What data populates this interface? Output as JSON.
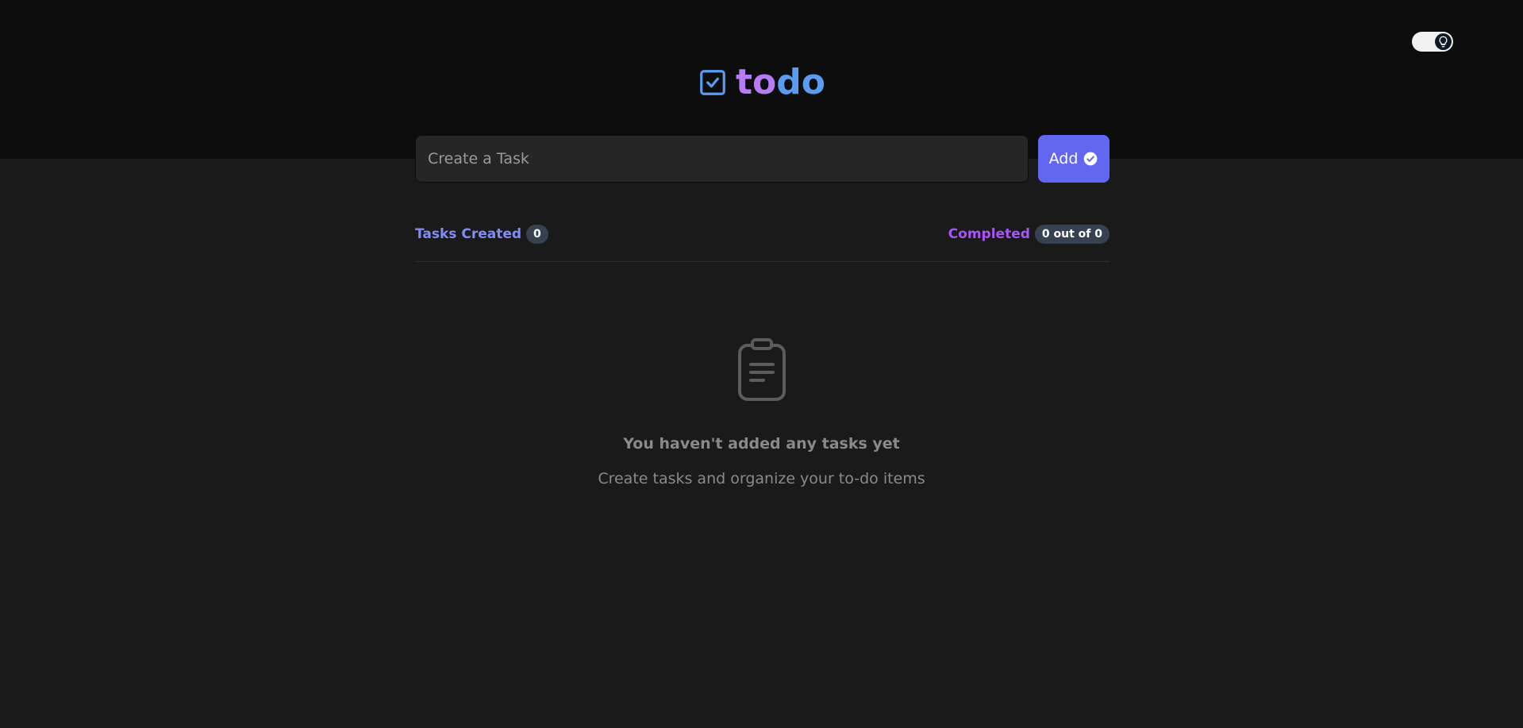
{
  "header": {
    "logo": {
      "icon": "checkbox-icon",
      "text_part1": "to",
      "text_part2": "do"
    },
    "theme_toggle": {
      "icon": "lightbulb-icon"
    }
  },
  "composer": {
    "input_placeholder": "Create a Task",
    "input_value": "",
    "add_label": "Add",
    "add_icon": "check-circle-icon"
  },
  "stats": {
    "created_label": "Tasks Created",
    "created_count": "0",
    "completed_label": "Completed",
    "completed_value": "0 out of 0"
  },
  "empty_state": {
    "icon": "clipboard-icon",
    "title": "You haven't added any tasks yet",
    "subtitle": "Create tasks and organize your to-do items"
  },
  "colors": {
    "header_bg": "#0d0d0d",
    "page_bg": "#1a1a1a",
    "accent": "#6366f1",
    "logo_to": "#b57cf4",
    "logo_do": "#5a9cf2",
    "created_label": "#818cf8",
    "completed_label": "#a855f7"
  }
}
